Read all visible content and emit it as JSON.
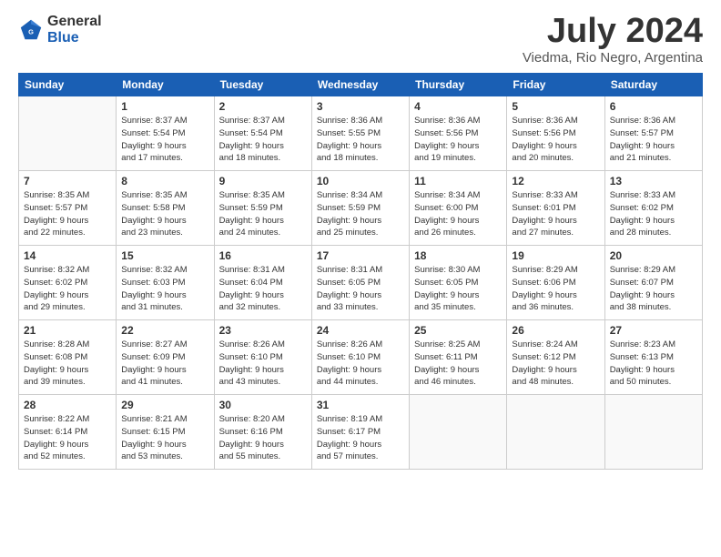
{
  "logo": {
    "general": "General",
    "blue": "Blue"
  },
  "title": "July 2024",
  "subtitle": "Viedma, Rio Negro, Argentina",
  "weekdays": [
    "Sunday",
    "Monday",
    "Tuesday",
    "Wednesday",
    "Thursday",
    "Friday",
    "Saturday"
  ],
  "weeks": [
    [
      {
        "day": "",
        "info": ""
      },
      {
        "day": "1",
        "info": "Sunrise: 8:37 AM\nSunset: 5:54 PM\nDaylight: 9 hours\nand 17 minutes."
      },
      {
        "day": "2",
        "info": "Sunrise: 8:37 AM\nSunset: 5:54 PM\nDaylight: 9 hours\nand 18 minutes."
      },
      {
        "day": "3",
        "info": "Sunrise: 8:36 AM\nSunset: 5:55 PM\nDaylight: 9 hours\nand 18 minutes."
      },
      {
        "day": "4",
        "info": "Sunrise: 8:36 AM\nSunset: 5:56 PM\nDaylight: 9 hours\nand 19 minutes."
      },
      {
        "day": "5",
        "info": "Sunrise: 8:36 AM\nSunset: 5:56 PM\nDaylight: 9 hours\nand 20 minutes."
      },
      {
        "day": "6",
        "info": "Sunrise: 8:36 AM\nSunset: 5:57 PM\nDaylight: 9 hours\nand 21 minutes."
      }
    ],
    [
      {
        "day": "7",
        "info": "Sunrise: 8:35 AM\nSunset: 5:57 PM\nDaylight: 9 hours\nand 22 minutes."
      },
      {
        "day": "8",
        "info": "Sunrise: 8:35 AM\nSunset: 5:58 PM\nDaylight: 9 hours\nand 23 minutes."
      },
      {
        "day": "9",
        "info": "Sunrise: 8:35 AM\nSunset: 5:59 PM\nDaylight: 9 hours\nand 24 minutes."
      },
      {
        "day": "10",
        "info": "Sunrise: 8:34 AM\nSunset: 5:59 PM\nDaylight: 9 hours\nand 25 minutes."
      },
      {
        "day": "11",
        "info": "Sunrise: 8:34 AM\nSunset: 6:00 PM\nDaylight: 9 hours\nand 26 minutes."
      },
      {
        "day": "12",
        "info": "Sunrise: 8:33 AM\nSunset: 6:01 PM\nDaylight: 9 hours\nand 27 minutes."
      },
      {
        "day": "13",
        "info": "Sunrise: 8:33 AM\nSunset: 6:02 PM\nDaylight: 9 hours\nand 28 minutes."
      }
    ],
    [
      {
        "day": "14",
        "info": "Sunrise: 8:32 AM\nSunset: 6:02 PM\nDaylight: 9 hours\nand 29 minutes."
      },
      {
        "day": "15",
        "info": "Sunrise: 8:32 AM\nSunset: 6:03 PM\nDaylight: 9 hours\nand 31 minutes."
      },
      {
        "day": "16",
        "info": "Sunrise: 8:31 AM\nSunset: 6:04 PM\nDaylight: 9 hours\nand 32 minutes."
      },
      {
        "day": "17",
        "info": "Sunrise: 8:31 AM\nSunset: 6:05 PM\nDaylight: 9 hours\nand 33 minutes."
      },
      {
        "day": "18",
        "info": "Sunrise: 8:30 AM\nSunset: 6:05 PM\nDaylight: 9 hours\nand 35 minutes."
      },
      {
        "day": "19",
        "info": "Sunrise: 8:29 AM\nSunset: 6:06 PM\nDaylight: 9 hours\nand 36 minutes."
      },
      {
        "day": "20",
        "info": "Sunrise: 8:29 AM\nSunset: 6:07 PM\nDaylight: 9 hours\nand 38 minutes."
      }
    ],
    [
      {
        "day": "21",
        "info": "Sunrise: 8:28 AM\nSunset: 6:08 PM\nDaylight: 9 hours\nand 39 minutes."
      },
      {
        "day": "22",
        "info": "Sunrise: 8:27 AM\nSunset: 6:09 PM\nDaylight: 9 hours\nand 41 minutes."
      },
      {
        "day": "23",
        "info": "Sunrise: 8:26 AM\nSunset: 6:10 PM\nDaylight: 9 hours\nand 43 minutes."
      },
      {
        "day": "24",
        "info": "Sunrise: 8:26 AM\nSunset: 6:10 PM\nDaylight: 9 hours\nand 44 minutes."
      },
      {
        "day": "25",
        "info": "Sunrise: 8:25 AM\nSunset: 6:11 PM\nDaylight: 9 hours\nand 46 minutes."
      },
      {
        "day": "26",
        "info": "Sunrise: 8:24 AM\nSunset: 6:12 PM\nDaylight: 9 hours\nand 48 minutes."
      },
      {
        "day": "27",
        "info": "Sunrise: 8:23 AM\nSunset: 6:13 PM\nDaylight: 9 hours\nand 50 minutes."
      }
    ],
    [
      {
        "day": "28",
        "info": "Sunrise: 8:22 AM\nSunset: 6:14 PM\nDaylight: 9 hours\nand 52 minutes."
      },
      {
        "day": "29",
        "info": "Sunrise: 8:21 AM\nSunset: 6:15 PM\nDaylight: 9 hours\nand 53 minutes."
      },
      {
        "day": "30",
        "info": "Sunrise: 8:20 AM\nSunset: 6:16 PM\nDaylight: 9 hours\nand 55 minutes."
      },
      {
        "day": "31",
        "info": "Sunrise: 8:19 AM\nSunset: 6:17 PM\nDaylight: 9 hours\nand 57 minutes."
      },
      {
        "day": "",
        "info": ""
      },
      {
        "day": "",
        "info": ""
      },
      {
        "day": "",
        "info": ""
      }
    ]
  ]
}
